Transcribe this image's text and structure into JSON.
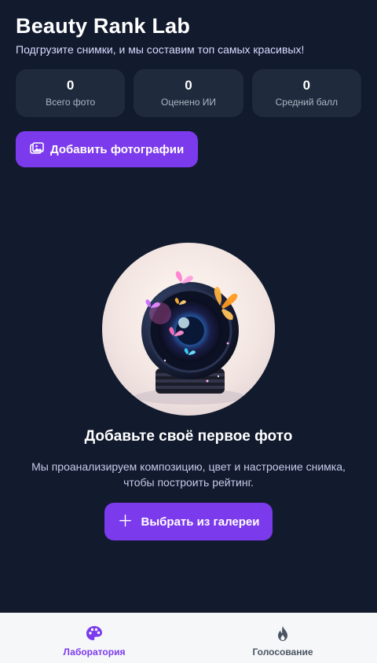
{
  "header": {
    "title": "Beauty Rank Lab",
    "subtitle": "Подгрузите снимки, и мы составим топ самых красивых!"
  },
  "stats": [
    {
      "value": "0",
      "label": "Всего фото"
    },
    {
      "value": "0",
      "label": "Оценено ИИ"
    },
    {
      "value": "0",
      "label": "Средний балл"
    }
  ],
  "actions": {
    "add_photos_label": "Добавить фотографии",
    "add_photos_icon": "image-icon"
  },
  "empty_state": {
    "title": "Добавьте своё первое фото",
    "description": "Мы проанализируем композицию, цвет и настроение снимка, чтобы построить рейтинг.",
    "gallery_button_label": "Выбрать из галереи",
    "gallery_button_icon": "plus-icon"
  },
  "bottom_nav": {
    "items": [
      {
        "label": "Лаборатория",
        "icon": "palette-icon",
        "active": true
      },
      {
        "label": "Голосование",
        "icon": "flame-icon",
        "active": false
      }
    ]
  },
  "colors": {
    "background": "#121a2e",
    "card": "#1f2a3c",
    "accent": "#7c3aed",
    "nav_background": "#f6f7f9"
  }
}
